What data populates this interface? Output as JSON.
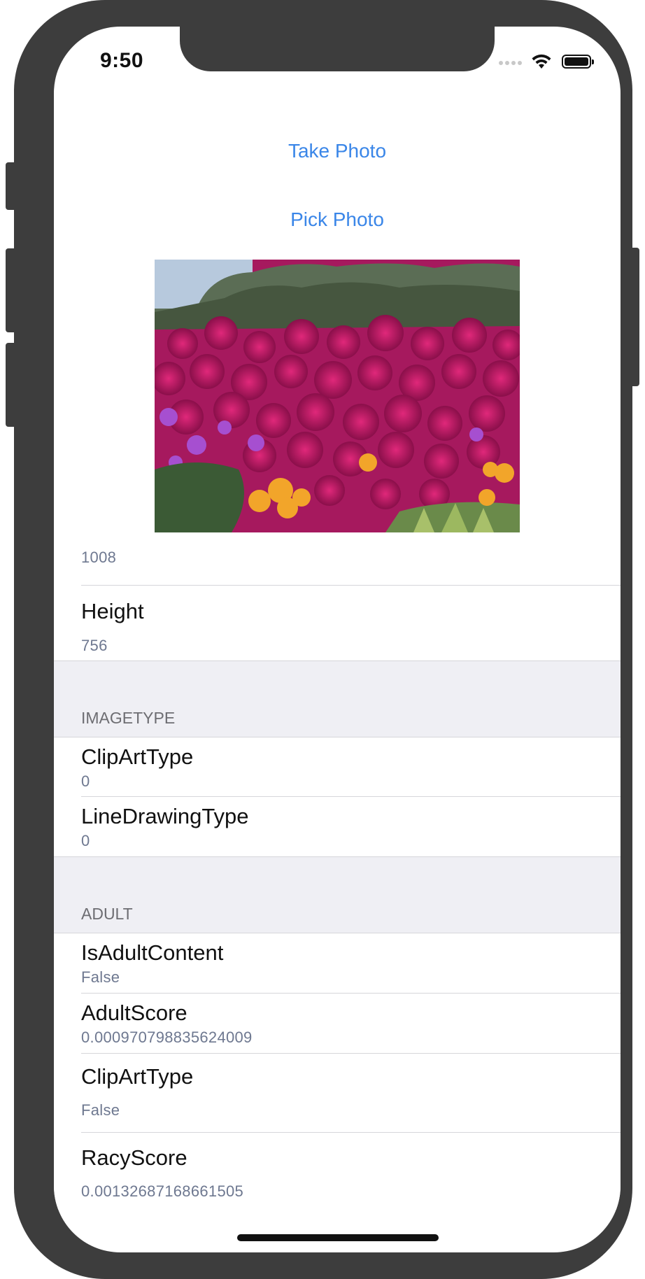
{
  "status": {
    "time": "9:50"
  },
  "actions": {
    "take_photo": "Take Photo",
    "pick_photo": "Pick Photo"
  },
  "photo": {
    "icon": "flower-photo"
  },
  "rows": {
    "width_value": "1008",
    "height_title": "Height",
    "height_value": "756"
  },
  "sections": {
    "imagetype": {
      "header": "IMAGETYPE",
      "items": [
        {
          "title": "ClipArtType",
          "value": "0"
        },
        {
          "title": "LineDrawingType",
          "value": "0"
        }
      ]
    },
    "adult": {
      "header": "ADULT",
      "items": [
        {
          "title": "IsAdultContent",
          "value": "False"
        },
        {
          "title": "AdultScore",
          "value": "0.000970798835624009"
        },
        {
          "title": "ClipArtType",
          "value": "False"
        },
        {
          "title": "RacyScore",
          "value": "0.00132687168661505"
        }
      ]
    }
  },
  "colors": {
    "link": "#3a86e8",
    "section_bg": "#efeff4",
    "value": "#6e7890"
  }
}
